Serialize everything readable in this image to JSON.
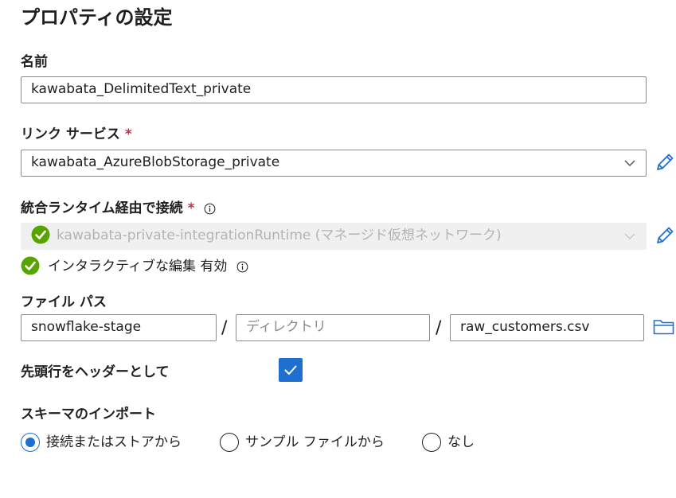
{
  "header": {
    "title": "プロパティの設定"
  },
  "name_field": {
    "label": "名前",
    "value": "kawabata_DelimitedText_private"
  },
  "linked_service": {
    "label": "リンク サービス",
    "required_mark": "*",
    "value": "kawabata_AzureBlobStorage_private",
    "edit_icon": "pencil-icon"
  },
  "integration_runtime": {
    "label": "統合ランタイム経由で接続",
    "required_mark": "*",
    "value": "kawabata-private-integrationRuntime (マネージド仮想ネットワーク)",
    "status_icon": "check-circle-icon",
    "edit_icon": "pencil-icon"
  },
  "interactive_authoring": {
    "text": "インタラクティブな編集 有効",
    "status_icon": "check-circle-icon"
  },
  "file_path": {
    "label": "ファイル パス",
    "container": "snowflake-stage",
    "directory_placeholder": "ディレクトリ",
    "file": "raw_customers.csv",
    "separator": "/",
    "browse_icon": "folder-icon"
  },
  "first_row_header": {
    "label": "先頭行をヘッダーとして",
    "checked": true
  },
  "import_schema": {
    "label": "スキーマのインポート",
    "options": [
      {
        "label": "接続またはストアから",
        "selected": true
      },
      {
        "label": "サンプル ファイルから",
        "selected": false
      },
      {
        "label": "なし",
        "selected": false
      }
    ]
  },
  "colors": {
    "accent": "#1f6fd1",
    "required": "#c4314b",
    "success": "#57a300"
  }
}
